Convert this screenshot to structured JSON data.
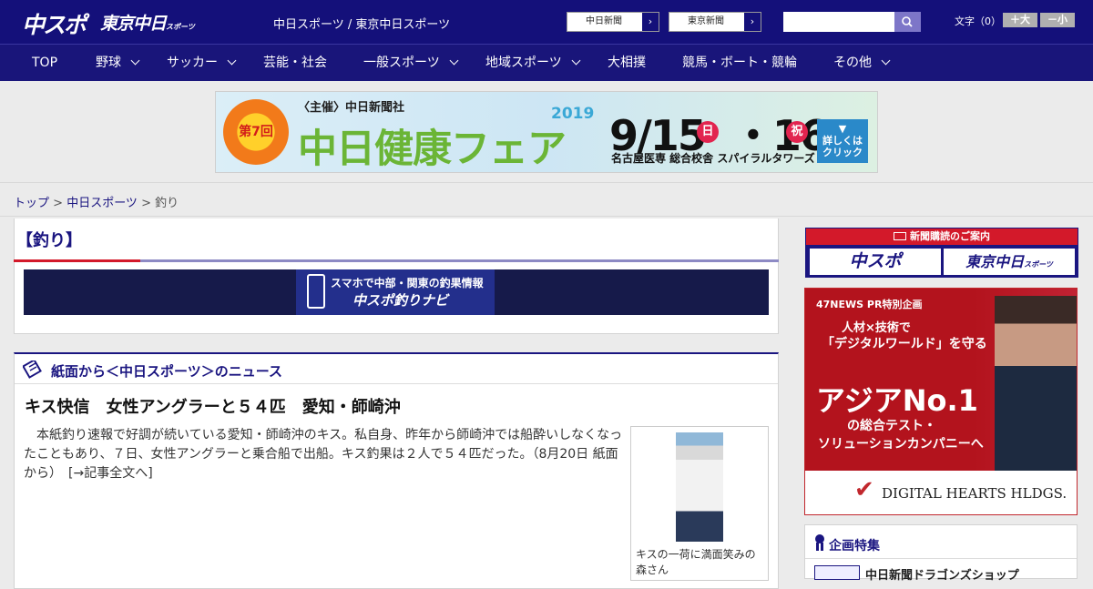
{
  "header": {
    "logo_chuspo": "中スポ",
    "logo_tokyo": "東京中日",
    "logo_tokyo_small": "スポーツ",
    "site_name": "中日スポーツ / 東京中日スポーツ",
    "links": [
      {
        "label": "中日新聞",
        "arrow": "›"
      },
      {
        "label": "東京新聞",
        "arrow": "›"
      }
    ],
    "search": {
      "placeholder": "",
      "value": "",
      "icon": "search-icon"
    },
    "font_size": {
      "label": "文字（0）",
      "increase": "＋大",
      "decrease": "－小"
    }
  },
  "nav": {
    "items": [
      {
        "label": "TOP"
      },
      {
        "label": "野球"
      },
      {
        "label": "サッカー"
      },
      {
        "label": "芸能・社会"
      },
      {
        "label": "一般スポーツ"
      },
      {
        "label": "地域スポーツ"
      },
      {
        "label": "大相撲"
      },
      {
        "label": "競馬・ボート・競輪"
      },
      {
        "label": "その他"
      }
    ]
  },
  "banner": {
    "badge": "第7回",
    "organizer": "〈主催〉中日新聞社",
    "title": "中日健康フェア",
    "year": "2019",
    "date": "9/15",
    "dow1": "日",
    "date2": "・16",
    "dow2": "祝",
    "venue": "名古屋医専 総合校舎 スパイラルタワーズ",
    "cta": "詳しくは クリック"
  },
  "breadcrumb": {
    "top": "トップ",
    "sep1": " > ",
    "mid": "中日スポーツ",
    "sep2": " > ",
    "current": "釣り"
  },
  "main": {
    "category_title": "【釣り】",
    "navi_banner": {
      "line1": "スマホで中部・関東の釣果情報",
      "line2": "中スポ釣りナビ"
    },
    "section_heading": "紙面から＜中日スポーツ＞のニュース",
    "article": {
      "title": "キス快信　女性アングラーと５４匹　愛知・師崎沖",
      "body": "本紙釣り速報で好調が続いている愛知・師崎沖のキス。私自身、昨年から師崎沖では船酔いしなくなったこともあり、７日、女性アングラーと乗合船で出船。キス釣果は２人で５４匹だった。（8月20日 紙面から）　[→記事全文へ]",
      "photo_caption": "キスの一荷に満面笑みの森さん"
    }
  },
  "sidebar": {
    "subscribe": {
      "heading": "新聞購読のご案内",
      "btn1": "中スポ",
      "btn2": "東京中日",
      "btn2_small": "スポーツ"
    },
    "ad": {
      "tag": "47NEWS PR特別企画",
      "line1": "人材×技術で",
      "line2": "「デジタルワールド」を守る",
      "line3": "アジアNo.1",
      "line4": "の総合テスト・",
      "line5": "ソリューションカンパニーへ",
      "brand": "DIGITAL HEARTS HLDGS."
    },
    "feature": {
      "heading": "企画特集",
      "item": "中日新聞ドラゴンズショップ"
    }
  },
  "colors": {
    "navy": "#14107a",
    "accent_red": "#d3192a",
    "link": "#1a1580"
  }
}
